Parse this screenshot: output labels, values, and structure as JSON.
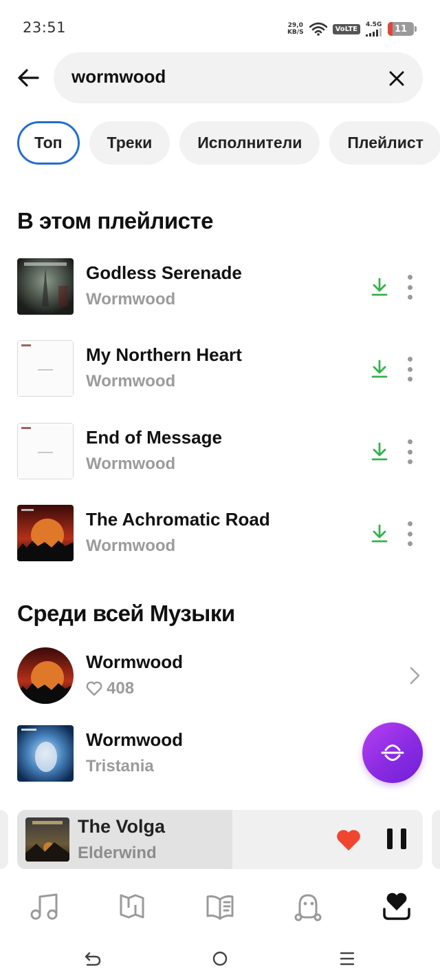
{
  "status_bar": {
    "time": "23:51",
    "net_speed_value": "29,0",
    "net_speed_unit": "KB/S",
    "volte": "VoLTE",
    "network": "4.5G",
    "battery": "11",
    "icons": [
      "wifi-icon",
      "signal-icon",
      "battery-icon"
    ]
  },
  "search": {
    "query": "wormwood",
    "back_icon": "back-arrow-icon",
    "clear_icon": "close-icon"
  },
  "filters": [
    {
      "label": "Топ",
      "active": true
    },
    {
      "label": "Треки",
      "active": false
    },
    {
      "label": "Исполнители",
      "active": false
    },
    {
      "label": "Плейлист",
      "active": false
    }
  ],
  "in_playlist": {
    "title": "В этом плейлисте",
    "tracks": [
      {
        "title": "Godless Serenade",
        "artist": "Wormwood",
        "downloaded": true
      },
      {
        "title": "My Northern Heart",
        "artist": "Wormwood",
        "downloaded": true
      },
      {
        "title": "End of Message",
        "artist": "Wormwood",
        "downloaded": true
      },
      {
        "title": "The Achromatic Road",
        "artist": "Wormwood",
        "downloaded": true
      }
    ]
  },
  "all_music": {
    "title": "Среди всей Музыки",
    "items": [
      {
        "title": "Wormwood",
        "likes": "408",
        "type": "artist"
      },
      {
        "title": "Wormwood",
        "subtitle": "Tristania",
        "type": "track"
      }
    ]
  },
  "fab": {
    "icon": "vibe-wave-icon"
  },
  "player": {
    "title": "The Volga",
    "artist": "Elderwind",
    "liked": true,
    "playing": true,
    "progress": 0.53
  },
  "bottom_nav": [
    {
      "icon": "music-note-icon"
    },
    {
      "icon": "map-icon"
    },
    {
      "icon": "book-icon"
    },
    {
      "icon": "kids-icon"
    },
    {
      "icon": "my-collection-icon",
      "active": true
    }
  ],
  "system_nav": [
    "system-back-icon",
    "system-home-icon",
    "system-menu-icon"
  ],
  "colors": {
    "accent_blue": "#1f6ed4",
    "download_green": "#33b24a",
    "like_red": "#f0452f",
    "fab_purple": "#8a2be2"
  }
}
